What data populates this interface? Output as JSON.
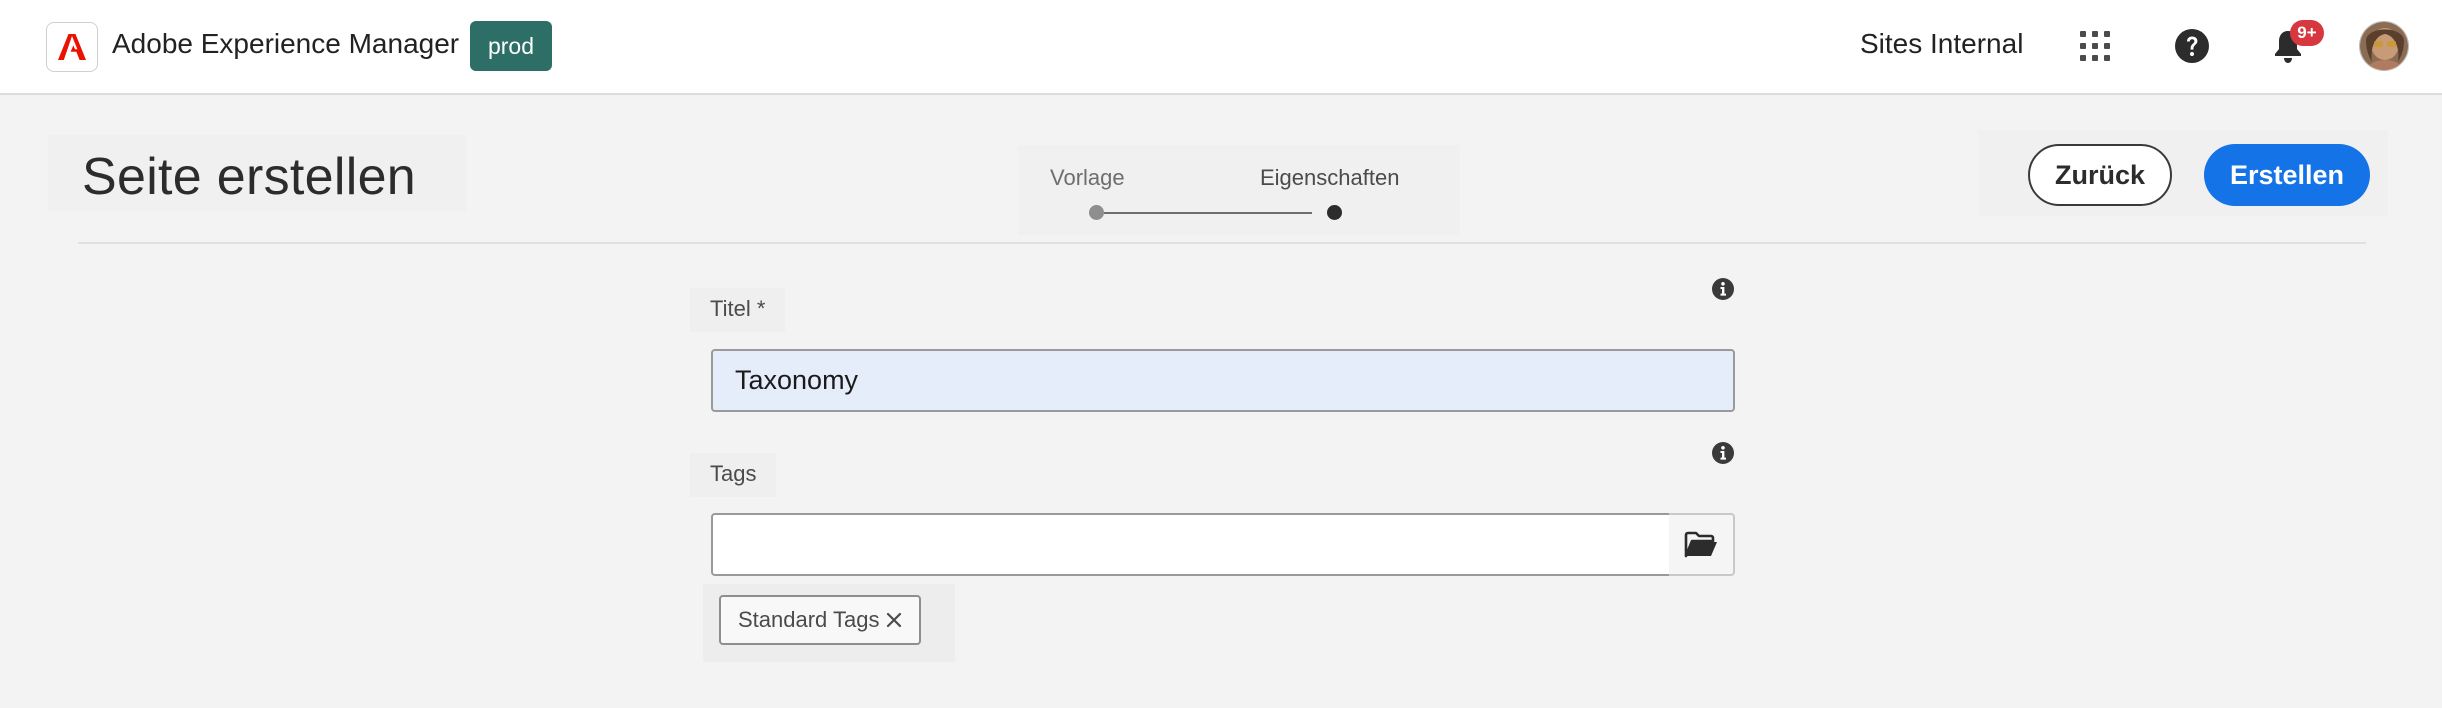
{
  "header": {
    "app_title": "Adobe Experience Manager",
    "env_badge": "prod",
    "org_switcher": "Sites Internal",
    "notifications_count": "9+",
    "icons": [
      "adobe-logo-icon",
      "app-grid-icon",
      "help-icon",
      "bell-icon",
      "avatar"
    ],
    "colors": {
      "adobe_red": "#eb1000",
      "env_badge_bg": "#2d6e66",
      "notification_badge": "#d7373f"
    }
  },
  "page": {
    "title": "Seite erstellen",
    "wizard_steps": [
      {
        "label": "Vorlage",
        "state": "completed"
      },
      {
        "label": "Eigenschaften",
        "state": "current"
      }
    ],
    "actions": {
      "back_label": "Zurück",
      "create_label": "Erstellen",
      "primary_color": "#1473e6"
    }
  },
  "form": {
    "title_field": {
      "label": "Titel *",
      "value": "Taxonomy"
    },
    "tags_field": {
      "label": "Tags",
      "value": "",
      "selected_tags": [
        "Standard Tags"
      ]
    }
  }
}
